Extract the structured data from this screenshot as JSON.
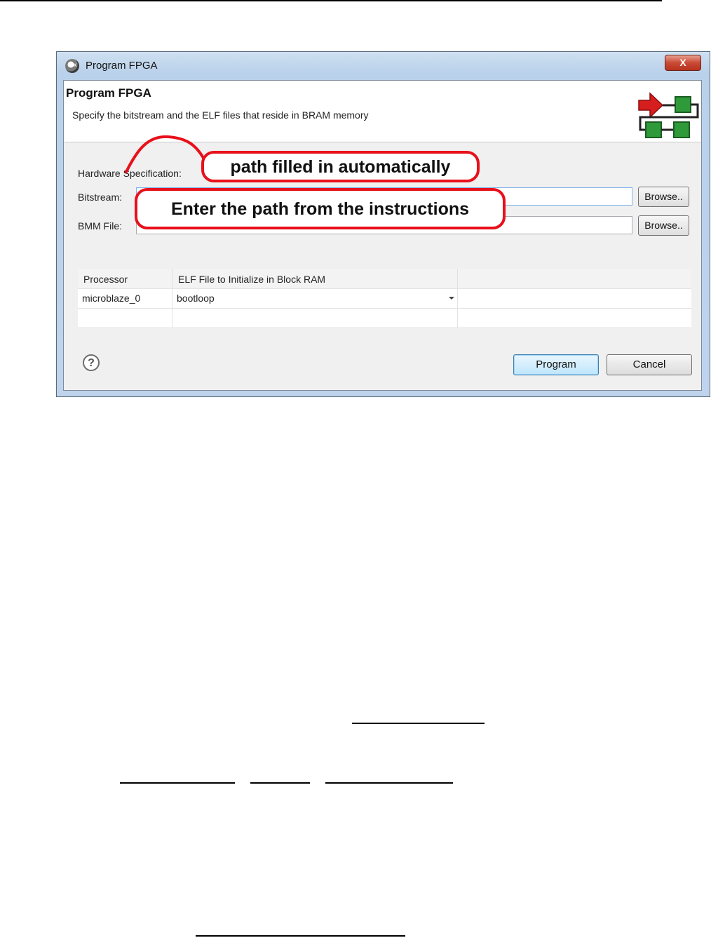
{
  "window": {
    "title": "Program FPGA",
    "app_icon": "sdk-gear-icon",
    "close_label": "X"
  },
  "header": {
    "title": "Program FPGA",
    "subtitle": "Specify the bitstream and the ELF files that reside in BRAM memory",
    "graphic": "wizard-arrow-blocks-icon"
  },
  "form": {
    "hardware_spec_label": "Hardware Specification:",
    "bitstream_label": "Bitstream:",
    "bitstream_value": "",
    "bmm_label": "BMM File:",
    "bmm_value": "",
    "browse_label": "Browse.."
  },
  "table": {
    "headers": [
      "Processor",
      "ELF File to Initialize in Block RAM",
      ""
    ],
    "rows": [
      [
        "microblaze_0",
        "bootloop",
        ""
      ]
    ]
  },
  "buttons": {
    "help_glyph": "?",
    "program": "Program",
    "cancel": "Cancel"
  },
  "annotations": {
    "callout_1": "path filled in automatically",
    "callout_2": "Enter the path from the instructions",
    "accent_color": "#e8101a"
  }
}
